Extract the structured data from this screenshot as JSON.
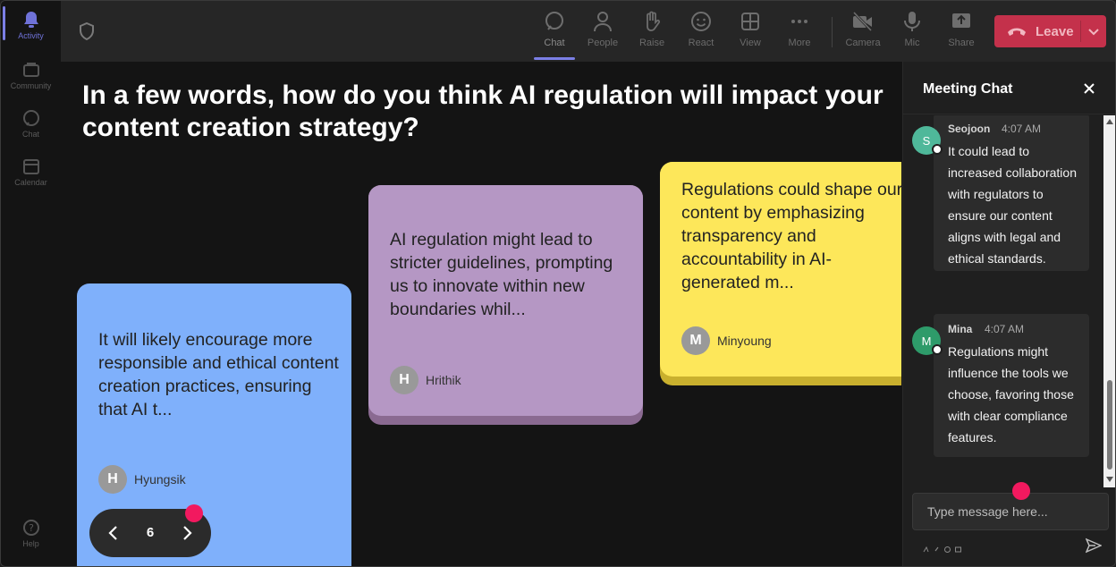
{
  "colors": {
    "accent": "#7b7fe6",
    "leave": "#c4314b",
    "note_blue": "#7fb0fb",
    "note_purple": "#b597c4",
    "note_yellow": "#fde75a",
    "pointer_dot": "#f2195f"
  },
  "rail": {
    "items": [
      {
        "label": "Activity",
        "icon": "bell-icon"
      },
      {
        "label": "Community",
        "icon": "community-icon"
      },
      {
        "label": "Chat",
        "icon": "chat-icon"
      },
      {
        "label": "Calendar",
        "icon": "calendar-icon"
      }
    ],
    "help": {
      "label": "Help",
      "icon": "help-icon"
    }
  },
  "toolbar": {
    "buttons": [
      {
        "label": "Chat",
        "icon": "chat-icon"
      },
      {
        "label": "People",
        "icon": "people-icon"
      },
      {
        "label": "Raise",
        "icon": "hand-icon"
      },
      {
        "label": "React",
        "icon": "smiley-icon"
      },
      {
        "label": "View",
        "icon": "grid-icon"
      },
      {
        "label": "More",
        "icon": "more-icon"
      },
      {
        "label": "Camera",
        "icon": "camera-off-icon"
      },
      {
        "label": "Mic",
        "icon": "mic-icon"
      },
      {
        "label": "Share",
        "icon": "share-icon"
      }
    ],
    "leave_label": "Leave"
  },
  "stage": {
    "question": "In a few words, how do you think AI regulation will impact your content creation strategy?",
    "notes": [
      {
        "text": "It will likely encourage more responsible and ethical content creation practices, ensuring that AI t...",
        "initial": "H",
        "author": "Hyungsik"
      },
      {
        "text": "AI regulation might lead to stricter guidelines, prompting us to innovate within new boundaries whil...",
        "initial": "H",
        "author": "Hrithik"
      },
      {
        "text": "Regulations could shape our content by emphasizing transparency and accountability in AI-generated m...",
        "initial": "M",
        "author": "Minyoung"
      }
    ],
    "pager": {
      "page": "6"
    }
  },
  "chat": {
    "title": "Meeting Chat",
    "messages": [
      {
        "initial": "S",
        "author": "Seojoon",
        "time": "4:07 AM",
        "text": "It could lead to increased collaboration with regulators to ensure our content aligns with legal and ethical standards.",
        "avatar_color": "#4fb89a"
      },
      {
        "initial": "M",
        "author": "Mina",
        "time": "4:07 AM",
        "text": "Regulations might influence the tools we choose, favoring those with clear compliance features.",
        "avatar_color": "#2e9b6a"
      }
    ],
    "compose_placeholder": "Type message here..."
  }
}
